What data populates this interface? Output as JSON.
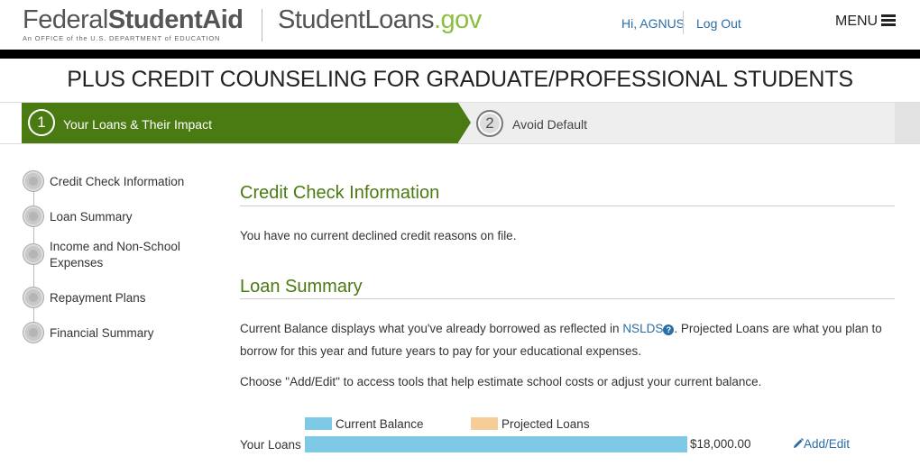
{
  "header": {
    "brand_left_regular": "Federal",
    "brand_left_bold": "Student",
    "brand_left_bold2": "Aid",
    "brand_left_sub": "An OFFICE of the U.S. DEPARTMENT of EDUCATION",
    "brand_right_main": "StudentLoans",
    "brand_right_tld": ".gov",
    "greeting": "Hi, AGNUS",
    "logout": "Log Out",
    "menu": "MENU"
  },
  "page_title": "PLUS CREDIT COUNSELING FOR GRADUATE/PROFESSIONAL STUDENTS",
  "steps": [
    {
      "number": "1",
      "label": "Your Loans & Their Impact",
      "active": true
    },
    {
      "number": "2",
      "label": "Avoid Default",
      "active": false
    }
  ],
  "nav": [
    {
      "label": "Credit Check Information"
    },
    {
      "label": "Loan Summary"
    },
    {
      "label": "Income and Non-School Expenses"
    },
    {
      "label": "Repayment Plans"
    },
    {
      "label": "Financial Summary"
    }
  ],
  "credit_check": {
    "heading": "Credit Check Information",
    "text": "You have no current declined credit reasons on file."
  },
  "loan_summary": {
    "heading": "Loan Summary",
    "text_before_link": "Current Balance displays what you've already borrowed as reflected in ",
    "link": "NSLDS",
    "help_icon": "?",
    "text_after_link": ". Projected Loans are what you plan to borrow for this year and future years to pay for your educational expenses.",
    "choose_text": "Choose \"Add/Edit\" to access tools that help estimate school costs or adjust your current balance."
  },
  "chart_data": {
    "type": "bar",
    "series": [
      {
        "name": "Current Balance",
        "color": "#7ecae6",
        "values": [
          18000
        ]
      },
      {
        "name": "Projected Loans",
        "color": "#f6cd96",
        "values": [
          0
        ]
      }
    ],
    "categories": [
      "Your Loans"
    ],
    "value_labels": [
      "$18,000.00"
    ],
    "action_label": "Add/Edit",
    "action_icon": "pencil-icon"
  }
}
